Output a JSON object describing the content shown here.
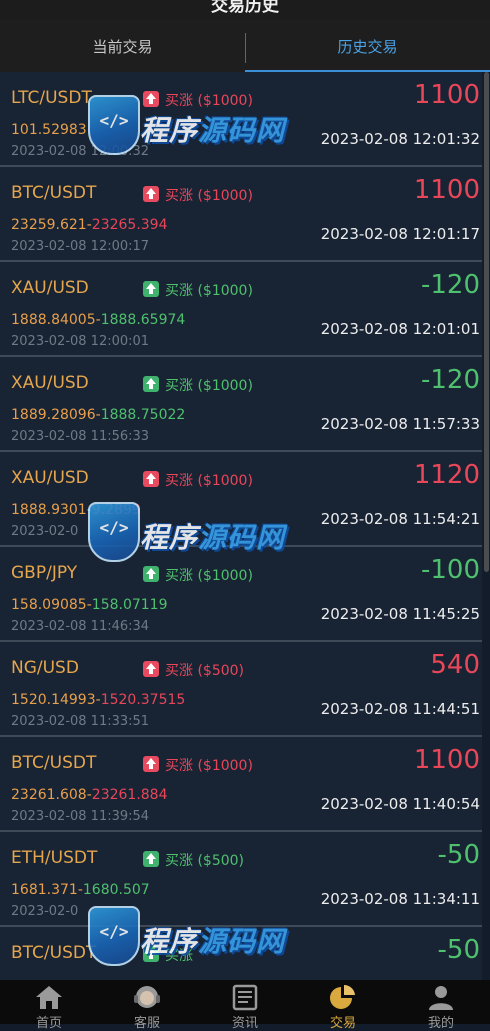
{
  "header": {
    "title": "交易历史"
  },
  "tabs": [
    {
      "label": "当前交易",
      "active": false
    },
    {
      "label": "历史交易",
      "active": true
    }
  ],
  "accent_color": "#4aa2e6",
  "up_color": "#e8475a",
  "down_color": "#4fc06d",
  "trades": [
    {
      "symbol": "LTC/USDT",
      "direction": "买涨",
      "amount": "($1000)",
      "open_price": "101.52983",
      "close_price": "",
      "open_time": "2023-02-08 12:00:32",
      "close_time": "2023-02-08 12:01:32",
      "pnl": "1100",
      "result": "win"
    },
    {
      "symbol": "BTC/USDT",
      "direction": "买涨",
      "amount": "($1000)",
      "open_price": "23259.621",
      "close_price": "23265.394",
      "open_time": "2023-02-08 12:00:17",
      "close_time": "2023-02-08 12:01:17",
      "pnl": "1100",
      "result": "win"
    },
    {
      "symbol": "XAU/USD",
      "direction": "买涨",
      "amount": "($1000)",
      "open_price": "1888.84005",
      "close_price": "1888.65974",
      "open_time": "2023-02-08 12:00:01",
      "close_time": "2023-02-08 12:01:01",
      "pnl": "-120",
      "result": "loss"
    },
    {
      "symbol": "XAU/USD",
      "direction": "买涨",
      "amount": "($1000)",
      "open_price": "1889.28096",
      "close_price": "1888.75022",
      "open_time": "2023-02-08 11:56:33",
      "close_time": "2023-02-08 11:57:33",
      "pnl": "-120",
      "result": "loss"
    },
    {
      "symbol": "XAU/USD",
      "direction": "买涨",
      "amount": "($1000)",
      "open_price": "1888.9301",
      "close_price": "9.2899",
      "open_time": "2023-02-0",
      "close_time": "2023-02-08 11:54:21",
      "pnl": "1120",
      "result": "win"
    },
    {
      "symbol": "GBP/JPY",
      "direction": "买涨",
      "amount": "($1000)",
      "open_price": "158.09085",
      "close_price": "158.07119",
      "open_time": "2023-02-08 11:46:34",
      "close_time": "2023-02-08 11:45:25",
      "pnl": "-100",
      "result": "loss"
    },
    {
      "symbol": "NG/USD",
      "direction": "买涨",
      "amount": "($500)",
      "open_price": "1520.14993",
      "close_price": "1520.37515",
      "open_time": "2023-02-08 11:33:51",
      "close_time": "2023-02-08 11:44:51",
      "pnl": "540",
      "result": "win"
    },
    {
      "symbol": "BTC/USDT",
      "direction": "买涨",
      "amount": "($1000)",
      "open_price": "23261.608",
      "close_price": "23261.884",
      "open_time": "2023-02-08 11:39:54",
      "close_time": "2023-02-08 11:40:54",
      "pnl": "1100",
      "result": "win"
    },
    {
      "symbol": "ETH/USDT",
      "direction": "买涨",
      "amount": "($500)",
      "open_price": "1681.371",
      "close_price": "1680.507",
      "open_time": "2023-02-0",
      "close_time": "2023-02-08 11:34:11",
      "pnl": "-50",
      "result": "loss"
    },
    {
      "symbol": "BTC/USDT",
      "direction": "买涨",
      "amount": "",
      "open_price": "",
      "close_price": "",
      "open_time": "",
      "close_time": "",
      "pnl": "-50",
      "result": "loss"
    }
  ],
  "watermark": {
    "text_a": "程序",
    "text_b": "源码网",
    "logo": "</>"
  },
  "bottom_nav": [
    {
      "label": "首页",
      "icon": "home-icon",
      "active": false
    },
    {
      "label": "客服",
      "icon": "support-icon",
      "active": false
    },
    {
      "label": "资讯",
      "icon": "news-icon",
      "active": false
    },
    {
      "label": "交易",
      "icon": "trade-icon",
      "active": true
    },
    {
      "label": "我的",
      "icon": "profile-icon",
      "active": false
    }
  ]
}
